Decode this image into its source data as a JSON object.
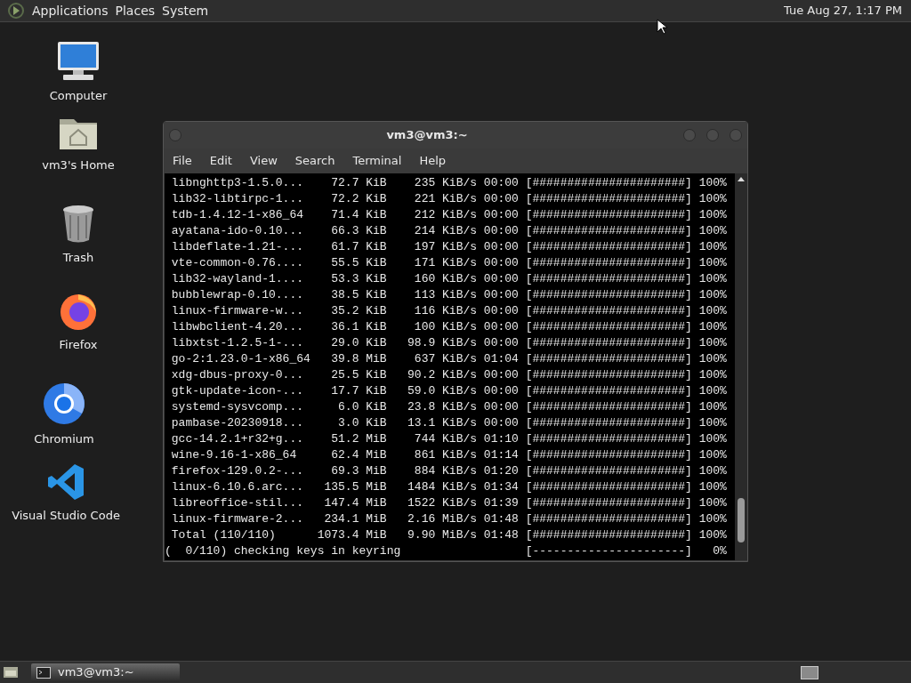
{
  "top_panel": {
    "menus": [
      "Applications",
      "Places",
      "System"
    ],
    "clock": "Tue Aug 27, 1:17 PM"
  },
  "desktop_icons": [
    {
      "kind": "computer",
      "label": "Computer"
    },
    {
      "kind": "home",
      "label": "vm3's Home"
    },
    {
      "kind": "trash",
      "label": "Trash"
    },
    {
      "kind": "firefox",
      "label": "Firefox"
    },
    {
      "kind": "chromium",
      "label": "Chromium"
    },
    {
      "kind": "vscode",
      "label": "Visual Studio Code"
    }
  ],
  "terminal": {
    "title": "vm3@vm3:~",
    "menu": [
      "File",
      "Edit",
      "View",
      "Search",
      "Terminal",
      "Help"
    ],
    "rows": [
      {
        "name": "libnghttp3-1.5.0...",
        "size": "72.7 KiB",
        "speed": "235 KiB/s",
        "time": "00:00",
        "bar": "[######################]",
        "percent": "100%"
      },
      {
        "name": "lib32-libtirpc-1...",
        "size": "72.2 KiB",
        "speed": "221 KiB/s",
        "time": "00:00",
        "bar": "[######################]",
        "percent": "100%"
      },
      {
        "name": "tdb-1.4.12-1-x86_64",
        "size": "71.4 KiB",
        "speed": "212 KiB/s",
        "time": "00:00",
        "bar": "[######################]",
        "percent": "100%"
      },
      {
        "name": "ayatana-ido-0.10...",
        "size": "66.3 KiB",
        "speed": "214 KiB/s",
        "time": "00:00",
        "bar": "[######################]",
        "percent": "100%"
      },
      {
        "name": "libdeflate-1.21-...",
        "size": "61.7 KiB",
        "speed": "197 KiB/s",
        "time": "00:00",
        "bar": "[######################]",
        "percent": "100%"
      },
      {
        "name": "vte-common-0.76....",
        "size": "55.5 KiB",
        "speed": "171 KiB/s",
        "time": "00:00",
        "bar": "[######################]",
        "percent": "100%"
      },
      {
        "name": "lib32-wayland-1....",
        "size": "53.3 KiB",
        "speed": "160 KiB/s",
        "time": "00:00",
        "bar": "[######################]",
        "percent": "100%"
      },
      {
        "name": "bubblewrap-0.10....",
        "size": "38.5 KiB",
        "speed": "113 KiB/s",
        "time": "00:00",
        "bar": "[######################]",
        "percent": "100%"
      },
      {
        "name": "linux-firmware-w...",
        "size": "35.2 KiB",
        "speed": "116 KiB/s",
        "time": "00:00",
        "bar": "[######################]",
        "percent": "100%"
      },
      {
        "name": "libwbclient-4.20...",
        "size": "36.1 KiB",
        "speed": "100 KiB/s",
        "time": "00:00",
        "bar": "[######################]",
        "percent": "100%"
      },
      {
        "name": "libxtst-1.2.5-1-...",
        "size": "29.0 KiB",
        "speed": "98.9 KiB/s",
        "time": "00:00",
        "bar": "[######################]",
        "percent": "100%"
      },
      {
        "name": "go-2:1.23.0-1-x86_64",
        "size": "39.8 MiB",
        "speed": "637 KiB/s",
        "time": "01:04",
        "bar": "[######################]",
        "percent": "100%"
      },
      {
        "name": "xdg-dbus-proxy-0...",
        "size": "25.5 KiB",
        "speed": "90.2 KiB/s",
        "time": "00:00",
        "bar": "[######################]",
        "percent": "100%"
      },
      {
        "name": "gtk-update-icon-...",
        "size": "17.7 KiB",
        "speed": "59.0 KiB/s",
        "time": "00:00",
        "bar": "[######################]",
        "percent": "100%"
      },
      {
        "name": "systemd-sysvcomp...",
        "size": "6.0 KiB",
        "speed": "23.8 KiB/s",
        "time": "00:00",
        "bar": "[######################]",
        "percent": "100%"
      },
      {
        "name": "pambase-20230918...",
        "size": "3.0 KiB",
        "speed": "13.1 KiB/s",
        "time": "00:00",
        "bar": "[######################]",
        "percent": "100%"
      },
      {
        "name": "gcc-14.2.1+r32+g...",
        "size": "51.2 MiB",
        "speed": "744 KiB/s",
        "time": "01:10",
        "bar": "[######################]",
        "percent": "100%"
      },
      {
        "name": "wine-9.16-1-x86_64",
        "size": "62.4 MiB",
        "speed": "861 KiB/s",
        "time": "01:14",
        "bar": "[######################]",
        "percent": "100%"
      },
      {
        "name": "firefox-129.0.2-...",
        "size": "69.3 MiB",
        "speed": "884 KiB/s",
        "time": "01:20",
        "bar": "[######################]",
        "percent": "100%"
      },
      {
        "name": "linux-6.10.6.arc...",
        "size": "135.5 MiB",
        "speed": "1484 KiB/s",
        "time": "01:34",
        "bar": "[######################]",
        "percent": "100%"
      },
      {
        "name": "libreoffice-stil...",
        "size": "147.4 MiB",
        "speed": "1522 KiB/s",
        "time": "01:39",
        "bar": "[######################]",
        "percent": "100%"
      },
      {
        "name": "linux-firmware-2...",
        "size": "234.1 MiB",
        "speed": "2.16 MiB/s",
        "time": "01:48",
        "bar": "[######################]",
        "percent": "100%"
      },
      {
        "name": "Total (110/110)",
        "size": "1073.4 MiB",
        "speed": "9.90 MiB/s",
        "time": "01:48",
        "bar": "[######################]",
        "percent": "100%"
      }
    ],
    "status": {
      "text": "(  0/110) checking keys in keyring",
      "bar": "[----------------------]",
      "percent": "0%"
    }
  },
  "taskbar": {
    "tasks": [
      {
        "label": "vm3@vm3:~",
        "selected": true
      }
    ]
  }
}
